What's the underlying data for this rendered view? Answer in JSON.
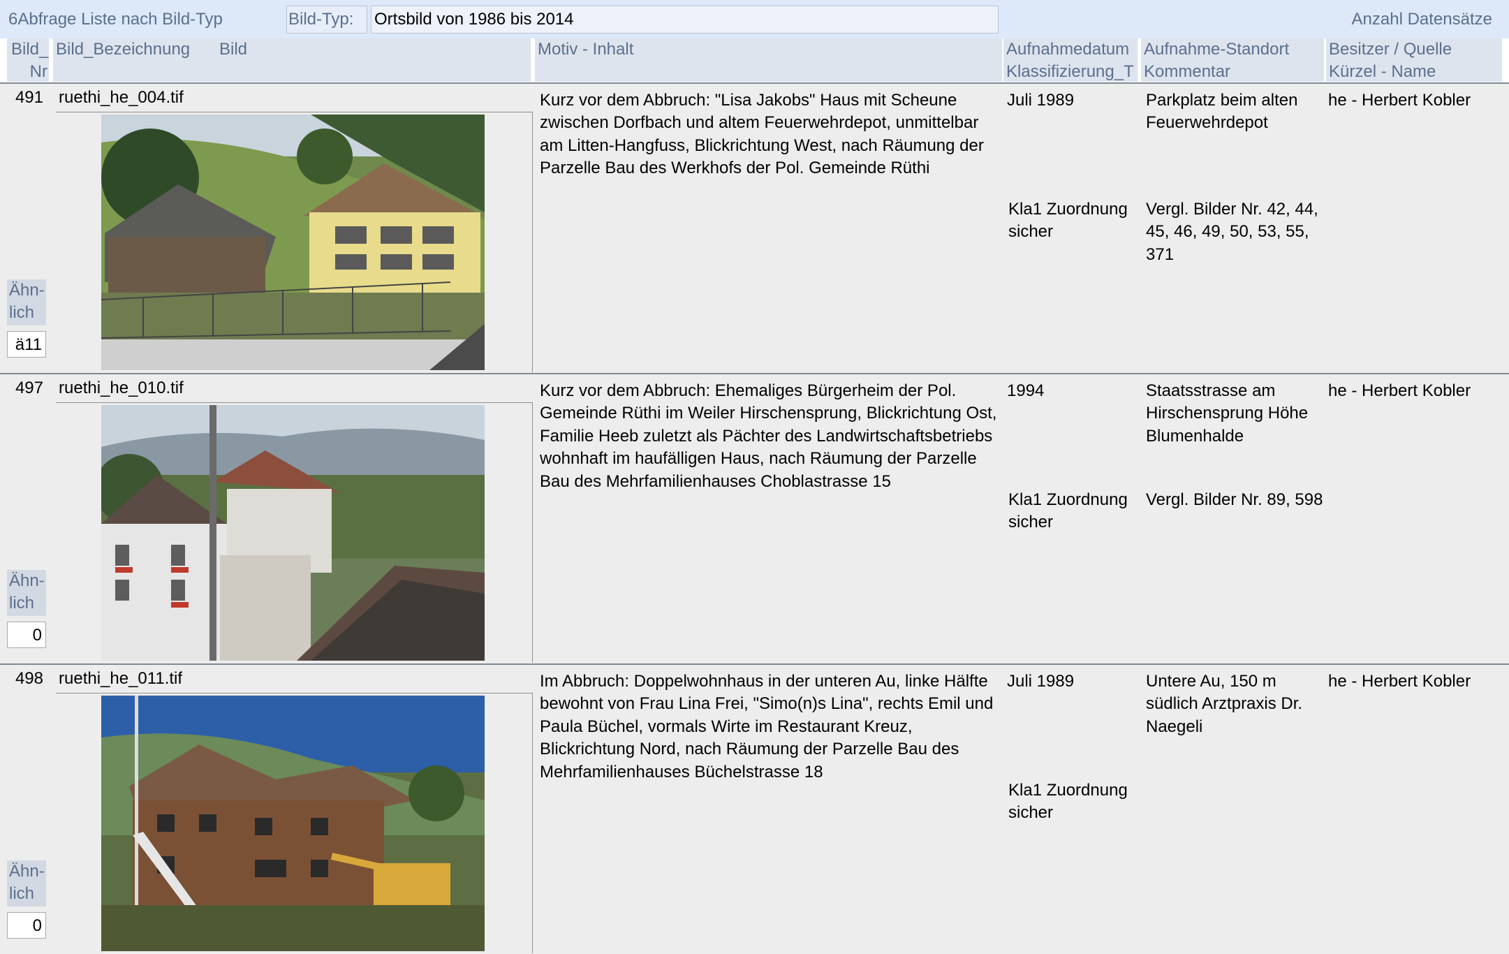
{
  "header": {
    "form_title": "6Abfrage Liste nach Bild-Typ",
    "bildtyp_label": "Bild-Typ:",
    "bildtyp_value": "Ortsbild von 1986 bis 2014",
    "count_label": "Anzahl Datensätze"
  },
  "columns": {
    "nr_l1": "Bild_",
    "nr_l2": "Nr",
    "bezeichnung": "Bild_Bezeichnung",
    "bild": "Bild",
    "motiv": "Motiv - Inhalt",
    "datum_l1": "Aufnahmedatum",
    "datum_l2": "Klassifizierung_T",
    "standort_l1": "Aufnahme-Standort",
    "standort_l2": "Kommentar",
    "besitzer_l1": "Besitzer / Quelle",
    "besitzer_l2": "Kürzel - Name"
  },
  "records": [
    {
      "nr": "491",
      "filename": "ruethi_he_004.tif",
      "photo_subject": "yellow-farmhouse-with-barn",
      "aehnlich_label": "Ähn-lich",
      "aehnlich_value": "ä11",
      "motiv": "Kurz vor dem Abbruch: \"Lisa Jakobs\" Haus mit Scheune zwischen Dorfbach und altem Feuerwehrdepot, unmittelbar am Litten-Hangfuss, Blickrichtung West, nach Räumung der Parzelle Bau des Werkhofs der Pol. Gemeinde Rüthi",
      "datum": "Juli 1989",
      "klassifizierung": "Kla1 Zuordnung sicher",
      "standort": "Parkplatz beim alten Feuerwehrdepot",
      "kommentar": "Vergl. Bilder Nr. 42, 44, 45, 46, 49, 50, 53, 55, 371",
      "besitzer": "he - Herbert Kobler"
    },
    {
      "nr": "497",
      "filename": "ruethi_he_010.tif",
      "photo_subject": "houses-with-flower-boxes",
      "aehnlich_label": "Ähn-lich",
      "aehnlich_value": "0",
      "motiv": "Kurz vor dem Abbruch: Ehemaliges Bürgerheim der Pol. Gemeinde Rüthi im Weiler Hirschensprung, Blickrichtung Ost, Familie Heeb zuletzt als Pächter des Landwirtschaftsbetriebs wohnhaft im haufälligen Haus, nach Räumung der Parzelle Bau des Mehrfamilienhauses Choblastrasse 15",
      "datum": "1994",
      "klassifizierung": "Kla1 Zuordnung sicher",
      "standort": "Staatsstrasse am Hirschensprung Höhe Blumenhalde",
      "kommentar": "Vergl. Bilder Nr. 89, 598",
      "besitzer": "he - Herbert Kobler"
    },
    {
      "nr": "498",
      "filename": "ruethi_he_011.tif",
      "photo_subject": "wooden-house-demolition-excavator",
      "aehnlich_label": "Ähn-lich",
      "aehnlich_value": "0",
      "motiv": "Im Abbruch: Doppelwohnhaus in der unteren Au, linke Hälfte bewohnt von Frau Lina Frei, \"Simo(n)s Lina\", rechts Emil und Paula Büchel, vormals Wirte im Restaurant Kreuz, Blickrichtung Nord, nach Räumung der Parzelle Bau des Mehrfamilienhauses Büchelstrasse 18",
      "datum": "Juli 1989",
      "klassifizierung": "Kla1 Zuordnung sicher",
      "standort": "Untere Au, 150 m südlich Arztpraxis Dr. Naegeli",
      "kommentar": "",
      "besitzer": "he - Herbert Kobler"
    }
  ]
}
